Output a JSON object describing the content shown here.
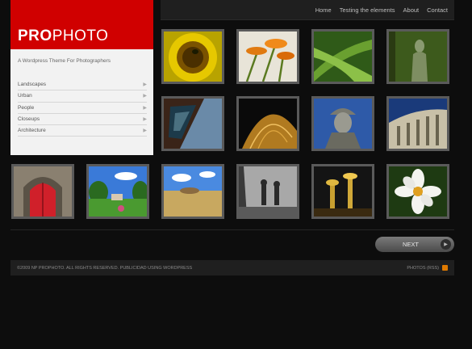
{
  "nav": {
    "items": [
      "Home",
      "Testing the elements",
      "About",
      "Contact"
    ]
  },
  "logo": {
    "bold": "PRO",
    "light": "PHOTO"
  },
  "tagline": "A Wordpress Theme For Photographers",
  "categories": [
    "Landscapes",
    "Urban",
    "People",
    "Closeups",
    "Architecture"
  ],
  "gallery": [
    "sunflower-bee",
    "orange-flowers",
    "green-plant",
    "forest-statue",
    "window-building",
    "dome-interior",
    "soldier-statue",
    "colonnade",
    "red-church-door",
    "garden-landscape",
    "round-fort-field",
    "park-sculptures",
    "night-towers",
    "white-flower"
  ],
  "pagination": {
    "next_label": "NEXT"
  },
  "footer": {
    "copyright": "©2009 NP PROPHOTO. ALL RIGHTS RESERVED. PUBLICIDAD USING WORDPRESS",
    "feed": "PHOTOS (RSS)"
  },
  "colors": {
    "brand_red": "#d00000",
    "background": "#0d0d0d",
    "sidebar_bg": "#f2f2f2",
    "rss_orange": "#e07a00"
  }
}
